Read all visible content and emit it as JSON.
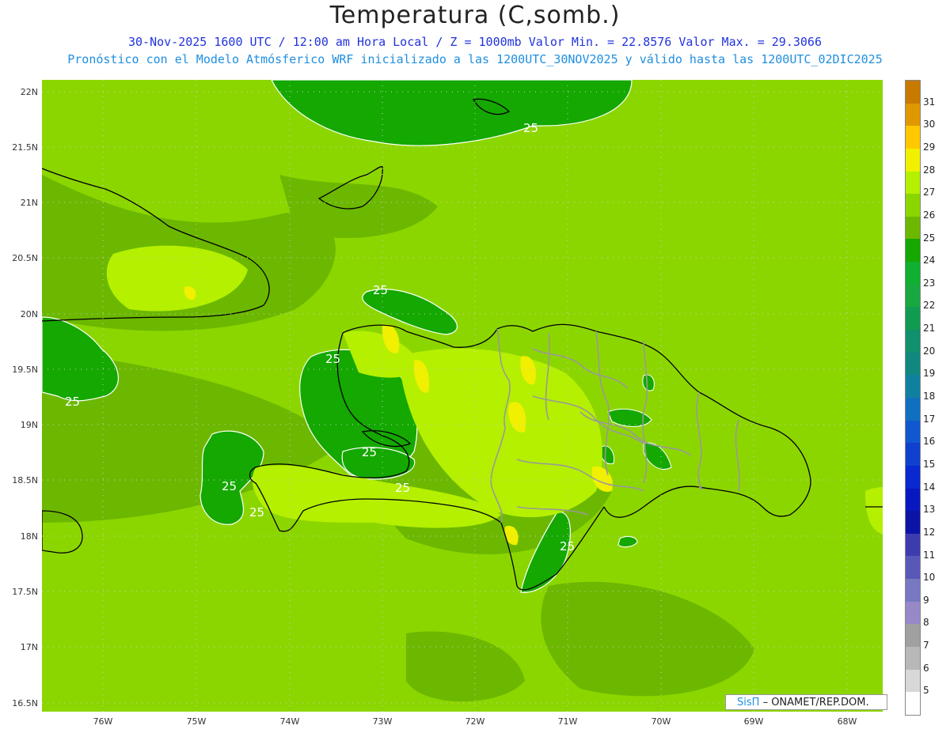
{
  "title": "Temperatura (C,somb.)",
  "subtitle1": "30-Nov-2025 1600 UTC / 12:00 am Hora Local / Z = 1000mb  Valor Min. = 22.8576  Valor Max. = 29.3066",
  "subtitle2": "Pronóstico con el Modelo Atmósferico WRF inicializado a las 1200UTC_30NOV2025 y válido hasta las  1200UTC_02DIC2025",
  "axes": {
    "y_ticks": [
      "22N",
      "21.5N",
      "21N",
      "20.5N",
      "20N",
      "19.5N",
      "19N",
      "18.5N",
      "18N",
      "17.5N",
      "17N",
      "16.5N"
    ],
    "x_ticks": [
      "76W",
      "75W",
      "74W",
      "73W",
      "72W",
      "71W",
      "70W",
      "69W",
      "68W"
    ]
  },
  "contour_labels": [
    "25",
    "25",
    "25",
    "25",
    "25",
    "25",
    "25",
    "25",
    "25"
  ],
  "legend": {
    "labels": [
      "31",
      "30",
      "29",
      "28",
      "27",
      "26",
      "25",
      "24",
      "23",
      "22",
      "21",
      "20",
      "19",
      "18",
      "17",
      "16",
      "15",
      "14",
      "13",
      "12",
      "11",
      "10",
      "9",
      "8",
      "7",
      "6",
      "5"
    ],
    "colors": [
      "#c87a00",
      "#e09800",
      "#ffc800",
      "#f0f000",
      "#b4f000",
      "#8cd600",
      "#6cb800",
      "#14a800",
      "#10b030",
      "#18a840",
      "#109c50",
      "#10906c",
      "#108880",
      "#1080a0",
      "#1070c0",
      "#1058d0",
      "#1040d0",
      "#0828d0",
      "#0818c0",
      "#0c14a8",
      "#3c3cb0",
      "#5858b8",
      "#7878c0",
      "#9888c8",
      "#a0a0a0",
      "#b8b8b8",
      "#d8d8d8",
      "#ffffff"
    ]
  },
  "credit": {
    "logo": "SisΠ",
    "text": "– ONAMET/REP.DOM."
  },
  "colors": {
    "band_24_25": "#14a800",
    "band_25_26": "#6cb800",
    "band_26_27": "#8cd600",
    "band_27_28": "#b4f000",
    "band_28_29": "#f0f000",
    "coast": "#000000",
    "borders": "#999999"
  }
}
